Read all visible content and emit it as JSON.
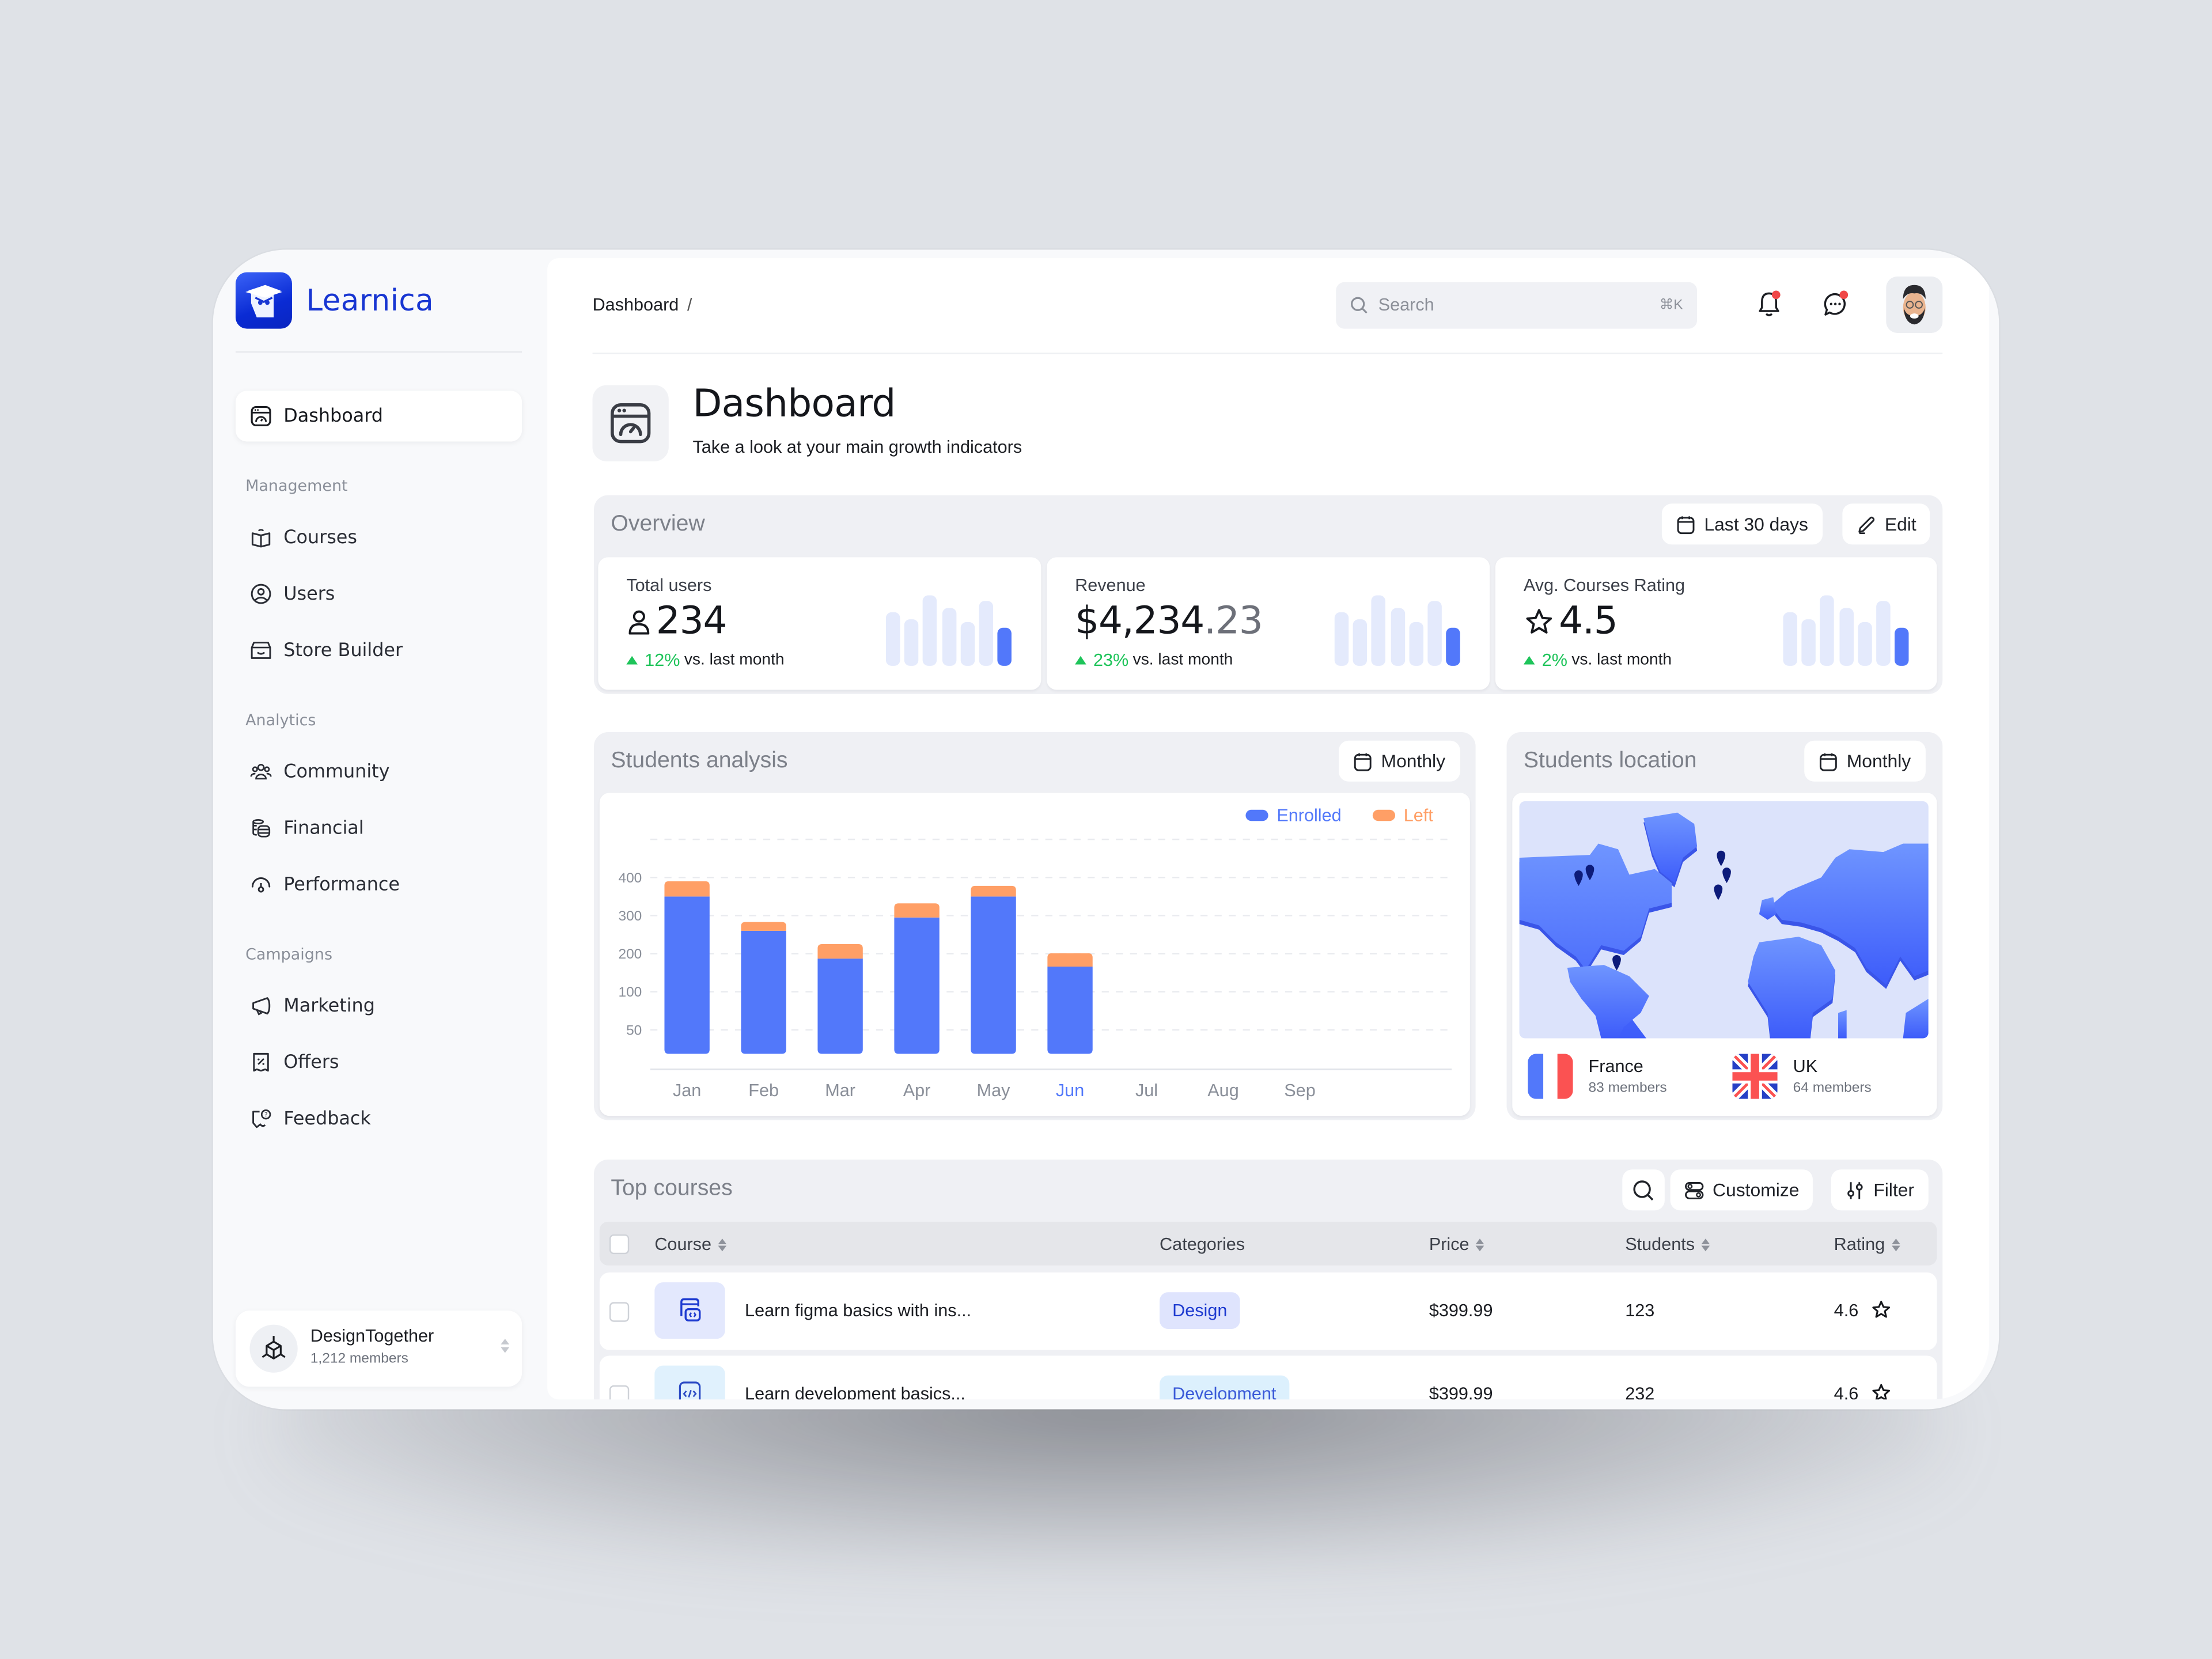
{
  "app": {
    "name": "Learnica",
    "colors": {
      "brand": "#1836d2",
      "accent": "#5278fa",
      "left": "#ff9f66",
      "positive": "#1ec45a",
      "notification": "#f04848"
    }
  },
  "sidebar": {
    "active_item": {
      "label": "Dashboard",
      "icon": "dashboard-gauge-icon"
    },
    "sections": [
      {
        "title": "Management",
        "items": [
          {
            "label": "Courses",
            "icon": "book-icon"
          },
          {
            "label": "Users",
            "icon": "user-circle-icon"
          },
          {
            "label": "Store Builder",
            "icon": "store-icon"
          }
        ]
      },
      {
        "title": "Analytics",
        "items": [
          {
            "label": "Community",
            "icon": "users-group-icon"
          },
          {
            "label": "Financial",
            "icon": "coins-icon"
          },
          {
            "label": "Performance",
            "icon": "speedometer-icon"
          }
        ]
      },
      {
        "title": "Campaigns",
        "items": [
          {
            "label": "Marketing",
            "icon": "megaphone-icon"
          },
          {
            "label": "Offers",
            "icon": "discount-receipt-icon"
          },
          {
            "label": "Feedback",
            "icon": "feedback-question-icon"
          }
        ]
      }
    ],
    "workspace": {
      "name": "DesignTogether",
      "members": "1,212 members",
      "icon": "cube-icon"
    }
  },
  "header": {
    "breadcrumb": "Dashboard",
    "breadcrumb_separator": "/",
    "search": {
      "placeholder": "Search",
      "shortcut": "⌘K"
    },
    "notifications_unread": true,
    "messages_unread": true
  },
  "page": {
    "title": "Dashboard",
    "subtitle": "Take a look at your main growth indicators"
  },
  "overview": {
    "title": "Overview",
    "range_button": "Last 30 days",
    "edit_button": "Edit",
    "stats": [
      {
        "label": "Total users",
        "icon": "user-icon",
        "value": "234",
        "value_decimal": "",
        "change": "12%",
        "change_suffix": "vs. last month",
        "trend": [
          0.77,
          0.67,
          1.0,
          0.83,
          0.62,
          0.93,
          0.54
        ]
      },
      {
        "label": "Revenue",
        "icon": "",
        "value": "$4,234",
        "value_decimal": ".23",
        "change": "23%",
        "change_suffix": "vs. last month",
        "trend": [
          0.77,
          0.67,
          1.0,
          0.83,
          0.62,
          0.93,
          0.54
        ]
      },
      {
        "label": "Avg. Courses Rating",
        "icon": "star-icon",
        "value": "4.5",
        "value_decimal": "",
        "change": "2%",
        "change_suffix": "vs. last month",
        "trend": [
          0.77,
          0.67,
          1.0,
          0.83,
          0.62,
          0.93,
          0.54
        ]
      }
    ]
  },
  "students_analysis": {
    "title": "Students analysis",
    "period_button": "Monthly",
    "highlighted_month": "Jun"
  },
  "chart_data": {
    "type": "bar",
    "stacked": true,
    "title": "Students analysis",
    "categories": [
      "Jan",
      "Feb",
      "Mar",
      "Apr",
      "May",
      "Jun",
      "Jul",
      "Aug",
      "Sep"
    ],
    "series": [
      {
        "name": "Enrolled",
        "color": "#5278fa",
        "values": [
          350,
          260,
          187,
          295,
          350,
          166,
          null,
          null,
          null
        ]
      },
      {
        "name": "Left",
        "color": "#ff9f66",
        "values": [
          40,
          23,
          38,
          37,
          28,
          35,
          null,
          null,
          null
        ]
      }
    ],
    "yticks": [
      50,
      100,
      200,
      300,
      400
    ],
    "y_scale": "ordinal-spaced ticks (50,100,200,300,400 evenly spaced)",
    "xlabel": "",
    "ylabel": "",
    "ylim": [
      0,
      500
    ],
    "grid": true,
    "legend": "top-right"
  },
  "students_location": {
    "title": "Students location",
    "period_button": "Monthly",
    "countries": [
      {
        "name": "France",
        "members": "83 members",
        "flag": "france-flag-icon"
      },
      {
        "name": "UK",
        "members": "64 members",
        "flag": "uk-flag-icon"
      }
    ]
  },
  "top_courses": {
    "title": "Top courses",
    "buttons": {
      "customize": "Customize",
      "filter": "Filter"
    },
    "columns": [
      "Course",
      "Categories",
      "Price",
      "Students",
      "Rating"
    ],
    "rows": [
      {
        "course": "Learn figma basics with ins...",
        "category": "Design",
        "price": "$399.99",
        "students": "123",
        "rating": "4.6",
        "icon": "design-window-icon"
      },
      {
        "course": "Learn development basics...",
        "category": "Development",
        "price": "$399.99",
        "students": "232",
        "rating": "4.6",
        "icon": "code-icon"
      }
    ]
  }
}
